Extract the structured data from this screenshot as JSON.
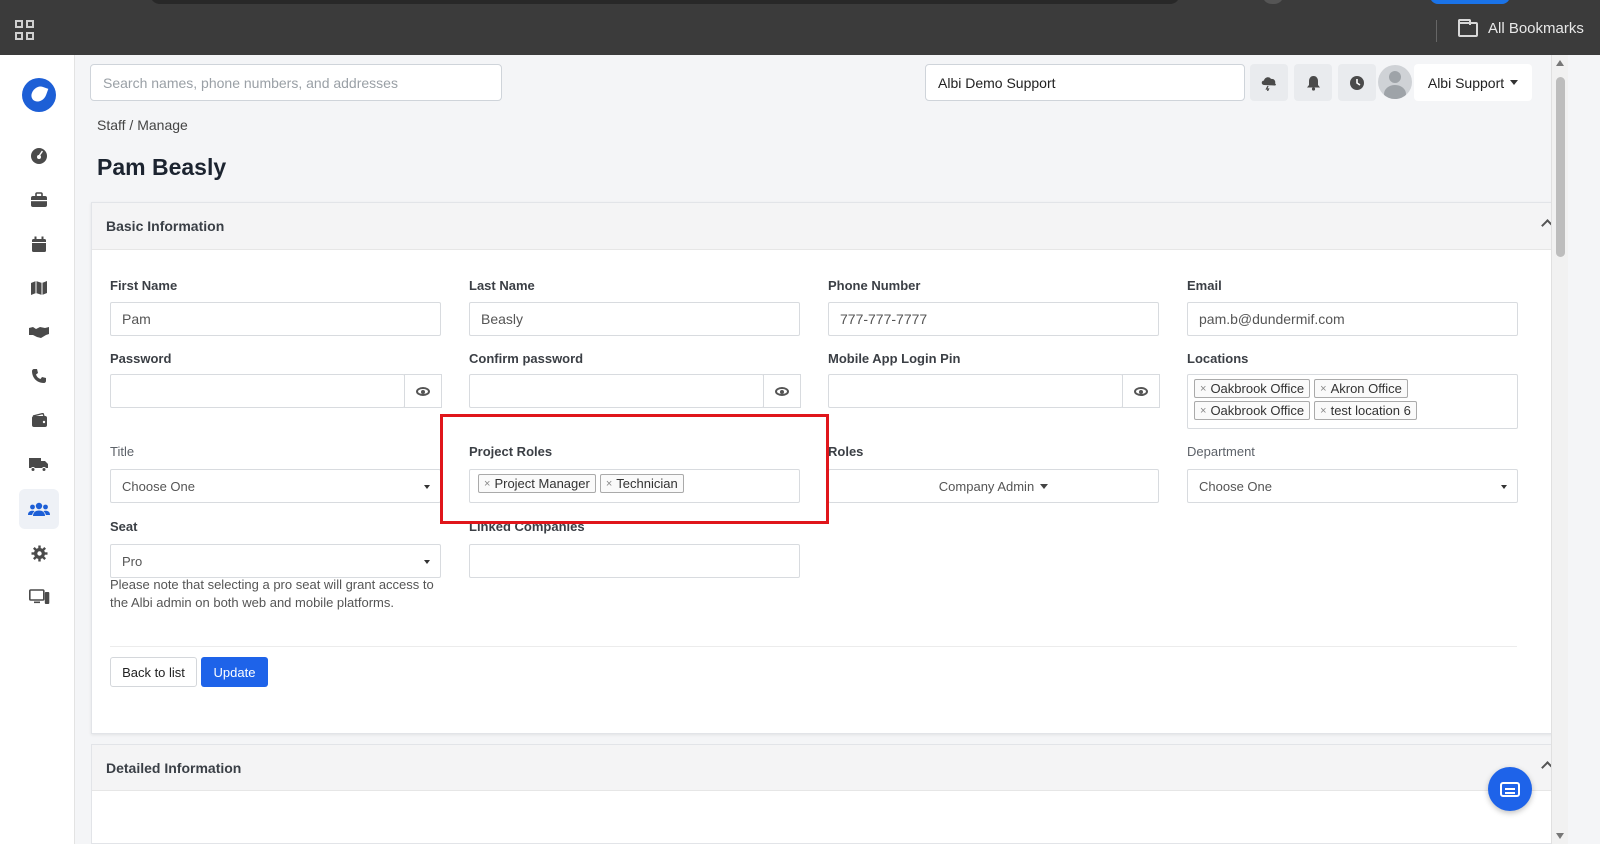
{
  "browser": {
    "bookmarks_label": "All Bookmarks"
  },
  "header": {
    "search_placeholder": "Search names, phone numbers, and addresses",
    "company": "Albi Demo Support",
    "user_name": "Albi Support"
  },
  "sidebar": {
    "items": [
      {
        "name": "dashboard",
        "icon": "dashboard-icon",
        "active": false
      },
      {
        "name": "jobs",
        "icon": "briefcase-icon",
        "active": false
      },
      {
        "name": "calendar",
        "icon": "calendar-icon",
        "active": false
      },
      {
        "name": "map",
        "icon": "map-icon",
        "active": false
      },
      {
        "name": "deals",
        "icon": "handshake-icon",
        "active": false
      },
      {
        "name": "calls",
        "icon": "phone-icon",
        "active": false
      },
      {
        "name": "wallet",
        "icon": "wallet-icon",
        "active": false
      },
      {
        "name": "fleet",
        "icon": "truck-icon",
        "active": false
      },
      {
        "name": "staff",
        "icon": "users-icon",
        "active": true
      },
      {
        "name": "settings",
        "icon": "gear-icon",
        "active": false
      },
      {
        "name": "devices",
        "icon": "monitor-icon",
        "active": false
      }
    ]
  },
  "breadcrumb": "Staff / Manage",
  "page_title": "Pam Beasly",
  "basic_info": {
    "heading": "Basic Information",
    "first_name_label": "First Name",
    "first_name": "Pam",
    "last_name_label": "Last Name",
    "last_name": "Beasly",
    "phone_label": "Phone Number",
    "phone": "777-777-7777",
    "email_label": "Email",
    "email": "pam.b@dundermif.com",
    "password_label": "Password",
    "confirm_password_label": "Confirm password",
    "pin_label": "Mobile App Login Pin",
    "locations_label": "Locations",
    "locations": [
      "Oakbrook Office",
      "Akron Office",
      "Oakbrook Office",
      "test location 6"
    ],
    "title_label": "Title",
    "title_value": "Choose One",
    "project_roles_label": "Project Roles",
    "project_roles": [
      "Project Manager",
      "Technician"
    ],
    "roles_label": "Roles",
    "roles_value": "Company Admin",
    "department_label": "Department",
    "department_value": "Choose One",
    "seat_label": "Seat",
    "seat_value": "Pro",
    "linked_companies_label": "Linked Companies",
    "seat_note": "Please note that selecting a pro seat will grant access to the Albi admin on both web and mobile platforms.",
    "back_label": "Back to list",
    "update_label": "Update"
  },
  "detailed_info": {
    "heading": "Detailed Information"
  },
  "colors": {
    "accent": "#1e63e9",
    "highlight": "#e0161b",
    "brand": "#1d5fd6"
  }
}
